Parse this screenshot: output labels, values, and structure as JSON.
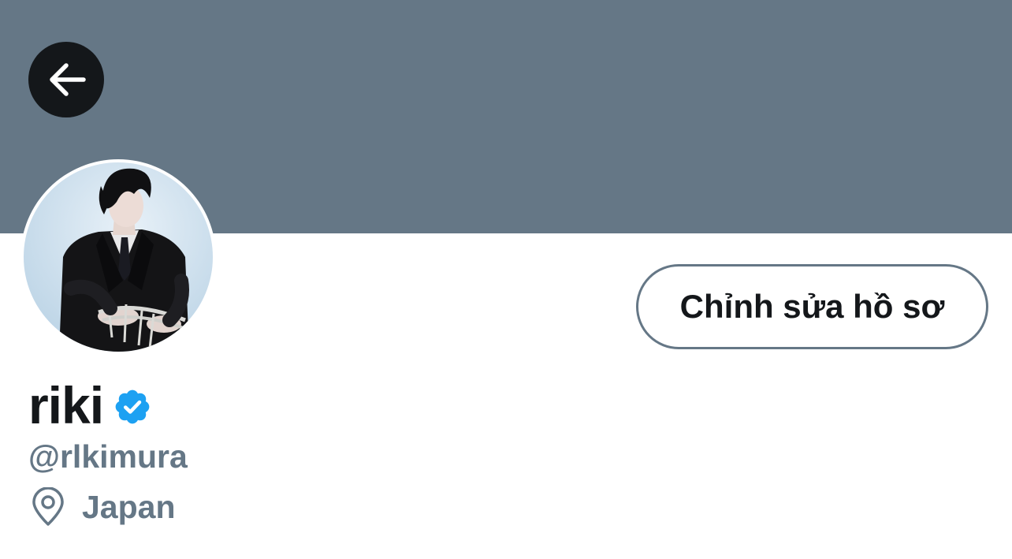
{
  "colors": {
    "banner": "#657786",
    "back_button_bg": "#14171a",
    "verified": "#1da1f2",
    "secondary_text": "#657786",
    "primary_text": "#14171a"
  },
  "header": {
    "back_icon": "arrow-left-icon"
  },
  "profile": {
    "display_name": "riki",
    "verified_icon": "verified-badge-icon",
    "handle": "@rlkimura",
    "location_icon": "map-pin-icon",
    "location": "Japan",
    "avatar": "profile-photo"
  },
  "actions": {
    "edit_profile_label": "Chỉnh sửa hồ sơ"
  }
}
